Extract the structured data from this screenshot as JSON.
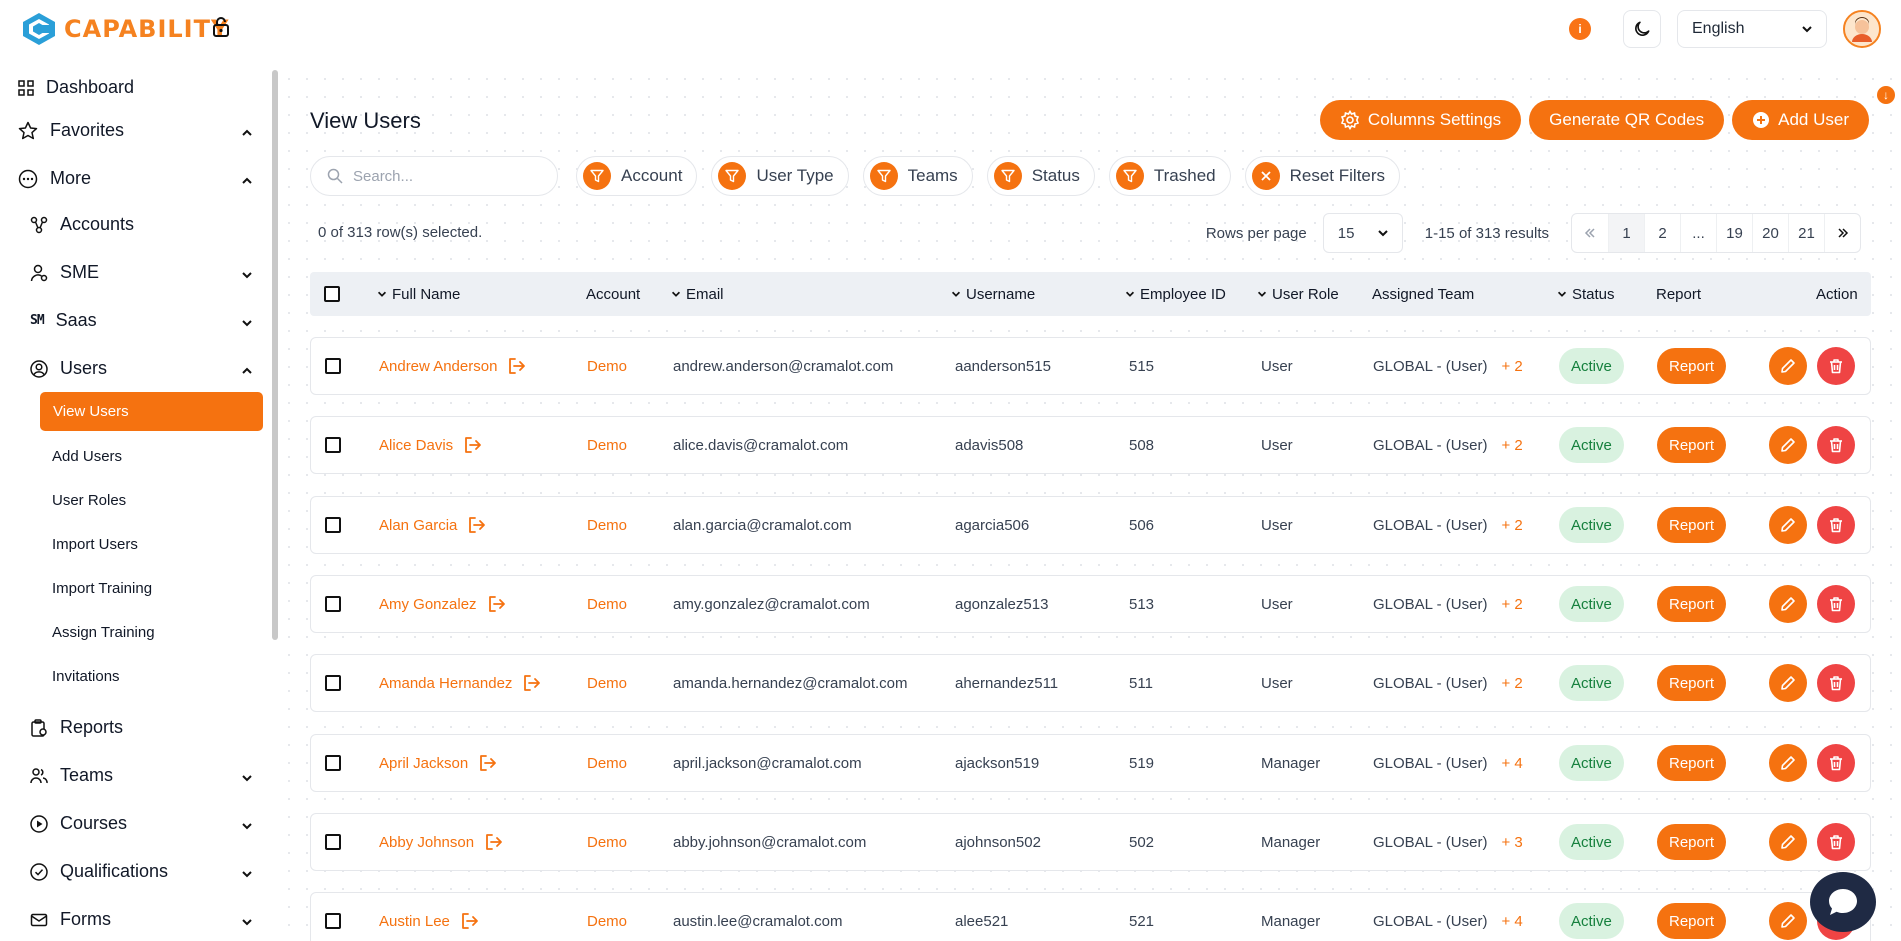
{
  "app": {
    "brand": "CAPABILITY",
    "notification_count": "i",
    "language": "English"
  },
  "sidebar": {
    "dashboard": "Dashboard",
    "favorites": "Favorites",
    "more": "More",
    "accounts": "Accounts",
    "sme": "SME",
    "saas": "Saas",
    "users": "Users",
    "users_sub": [
      "View Users",
      "Add Users",
      "User Roles",
      "Import Users",
      "Import Training",
      "Assign Training",
      "Invitations"
    ],
    "reports": "Reports",
    "teams": "Teams",
    "courses": "Courses",
    "qualifications": "Qualifications",
    "forms": "Forms"
  },
  "page": {
    "title": "View Users",
    "columns_settings": "Columns Settings",
    "generate_qr": "Generate QR Codes",
    "add_user": "Add User",
    "search_placeholder": "Search...",
    "filters": [
      "Account",
      "User Type",
      "Teams",
      "Status",
      "Trashed"
    ],
    "reset_filters": "Reset Filters",
    "selection_info": "0 of 313 row(s) selected.",
    "rows_per_page_label": "Rows per page",
    "rows_per_page": "15",
    "results": "1-15 of 313 results",
    "pages": [
      "1",
      "2",
      "...",
      "19",
      "20",
      "21"
    ]
  },
  "table": {
    "headers": {
      "full_name": "Full Name",
      "account": "Account",
      "email": "Email",
      "username": "Username",
      "employee_id": "Employee ID",
      "user_role": "User Role",
      "assigned_team": "Assigned Team",
      "status": "Status",
      "report": "Report",
      "action": "Action"
    },
    "rows": [
      {
        "name": "Andrew Anderson",
        "account": "Demo",
        "email": "andrew.anderson@cramalot.com",
        "username": "aanderson515",
        "emp_id": "515",
        "role": "User",
        "team": "GLOBAL - (User)",
        "extra": "+ 2",
        "status": "Active",
        "report": "Report"
      },
      {
        "name": "Alice Davis",
        "account": "Demo",
        "email": "alice.davis@cramalot.com",
        "username": "adavis508",
        "emp_id": "508",
        "role": "User",
        "team": "GLOBAL - (User)",
        "extra": "+ 2",
        "status": "Active",
        "report": "Report"
      },
      {
        "name": "Alan Garcia",
        "account": "Demo",
        "email": "alan.garcia@cramalot.com",
        "username": "agarcia506",
        "emp_id": "506",
        "role": "User",
        "team": "GLOBAL - (User)",
        "extra": "+ 2",
        "status": "Active",
        "report": "Report"
      },
      {
        "name": "Amy Gonzalez",
        "account": "Demo",
        "email": "amy.gonzalez@cramalot.com",
        "username": "agonzalez513",
        "emp_id": "513",
        "role": "User",
        "team": "GLOBAL - (User)",
        "extra": "+ 2",
        "status": "Active",
        "report": "Report"
      },
      {
        "name": "Amanda Hernandez",
        "account": "Demo",
        "email": "amanda.hernandez@cramalot.com",
        "username": "ahernandez511",
        "emp_id": "511",
        "role": "User",
        "team": "GLOBAL - (User)",
        "extra": "+ 2",
        "status": "Active",
        "report": "Report"
      },
      {
        "name": "April Jackson",
        "account": "Demo",
        "email": "april.jackson@cramalot.com",
        "username": "ajackson519",
        "emp_id": "519",
        "role": "Manager",
        "team": "GLOBAL - (User)",
        "extra": "+ 4",
        "status": "Active",
        "report": "Report"
      },
      {
        "name": "Abby Johnson",
        "account": "Demo",
        "email": "abby.johnson@cramalot.com",
        "username": "ajohnson502",
        "emp_id": "502",
        "role": "Manager",
        "team": "GLOBAL - (User)",
        "extra": "+ 3",
        "status": "Active",
        "report": "Report"
      },
      {
        "name": "Austin Lee",
        "account": "Demo",
        "email": "austin.lee@cramalot.com",
        "username": "alee521",
        "emp_id": "521",
        "role": "Manager",
        "team": "GLOBAL - (User)",
        "extra": "+ 4",
        "status": "Active",
        "report": "Report"
      }
    ]
  },
  "colors": {
    "accent": "#f57210",
    "danger": "#ef4444",
    "active_bg": "#d9f2e0",
    "active_text": "#15803d",
    "chat": "#1f2a44"
  }
}
